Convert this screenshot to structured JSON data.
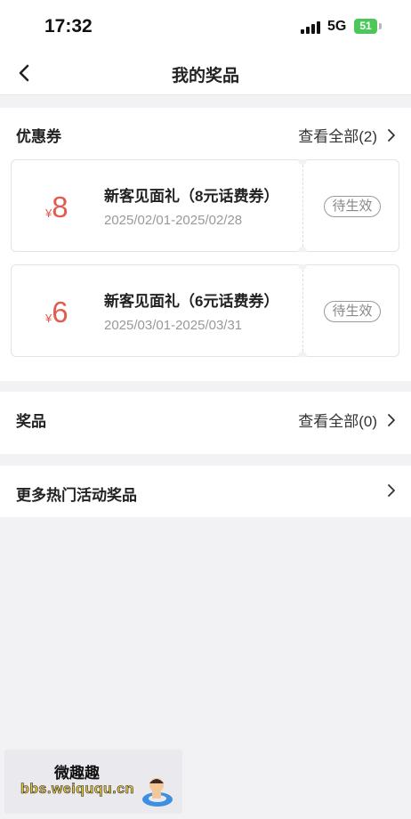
{
  "status_bar": {
    "time": "17:32",
    "network": "5G",
    "battery": "51"
  },
  "nav": {
    "title": "我的奖品",
    "back_icon": "chevron-left-icon"
  },
  "coupons_section": {
    "title": "优惠券",
    "view_all": "查看全部(2)",
    "items": [
      {
        "currency": "¥",
        "amount": "8",
        "name": "新客见面礼（8元话费券）",
        "date_range": "2025/02/01-2025/02/28",
        "status": "待生效"
      },
      {
        "currency": "¥",
        "amount": "6",
        "name": "新客见面礼（6元话费券）",
        "date_range": "2025/03/01-2025/03/31",
        "status": "待生效"
      }
    ]
  },
  "prizes_section": {
    "title": "奖品",
    "view_all": "查看全部(0)"
  },
  "more_section": {
    "title": "更多热门活动奖品"
  },
  "watermark": {
    "line1": "微趣趣",
    "line2": "bbs.weiququ.cn"
  },
  "colors": {
    "coupon_amount": "#e35a4f",
    "battery": "#4cc85a",
    "background": "#f2f2f4"
  }
}
